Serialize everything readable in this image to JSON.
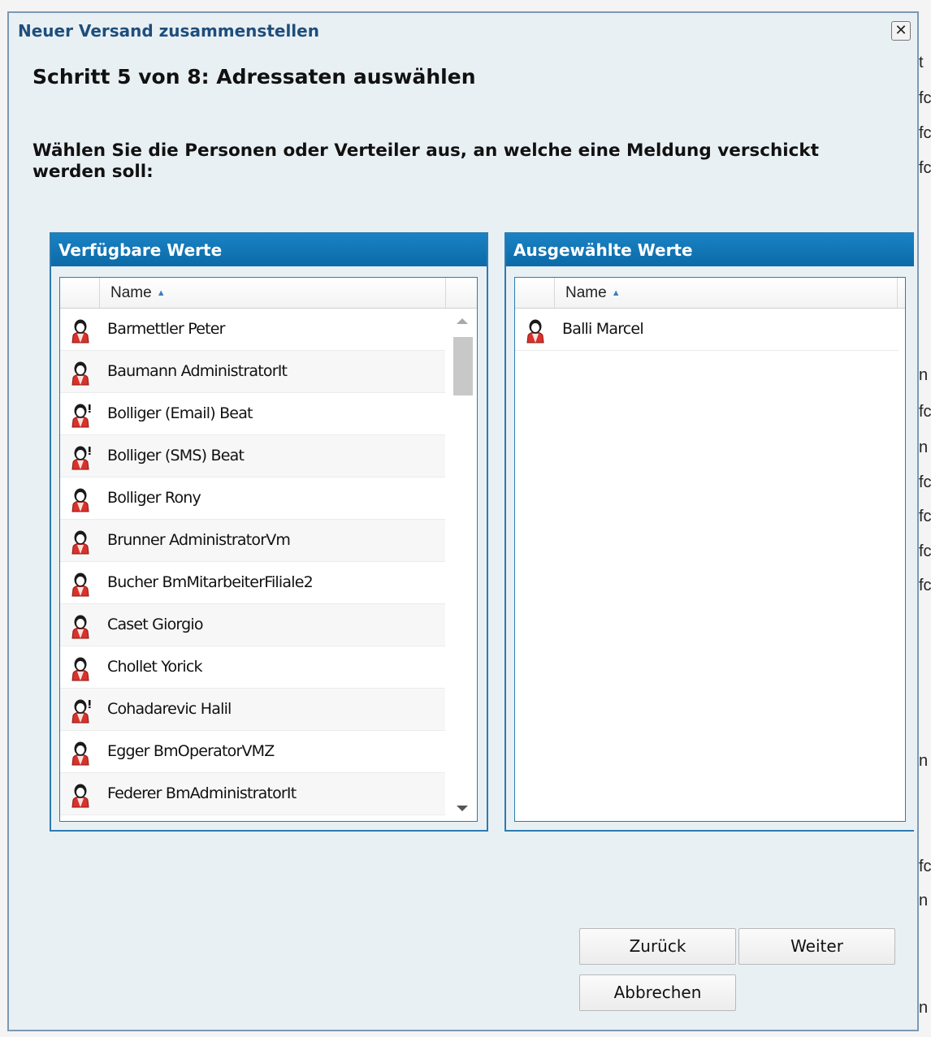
{
  "dialog": {
    "title": "Neuer Versand zusammenstellen",
    "close_symbol": "✕",
    "step_title": "Schritt 5 von 8: Adressaten auswählen",
    "instruction": "Wählen Sie die Personen oder Verteiler aus, an welche eine Meldung verschickt werden soll:"
  },
  "available": {
    "header": "Verfügbare Werte",
    "column_name": "Name",
    "sort_indicator": "▲",
    "items": [
      {
        "label": "Barmettler Peter",
        "icon": "person-icon"
      },
      {
        "label": "Baumann AdministratorIt",
        "icon": "person-icon"
      },
      {
        "label": "Bolliger (Email) Beat",
        "icon": "person-alert-icon"
      },
      {
        "label": "Bolliger (SMS) Beat",
        "icon": "person-alert-icon"
      },
      {
        "label": "Bolliger Rony",
        "icon": "person-icon"
      },
      {
        "label": "Brunner AdministratorVm",
        "icon": "person-icon"
      },
      {
        "label": "Bucher BmMitarbeiterFiliale2",
        "icon": "person-icon"
      },
      {
        "label": "Caset Giorgio",
        "icon": "person-icon"
      },
      {
        "label": "Chollet Yorick",
        "icon": "person-icon"
      },
      {
        "label": "Cohadarevic Halil",
        "icon": "person-alert-icon"
      },
      {
        "label": "Egger BmOperatorVMZ",
        "icon": "person-icon"
      },
      {
        "label": "Federer BmAdministratorIt",
        "icon": "person-icon"
      }
    ]
  },
  "selected": {
    "header": "Ausgewählte Werte",
    "column_name": "Name",
    "sort_indicator": "▲",
    "items": [
      {
        "label": "Balli Marcel",
        "icon": "person-icon"
      }
    ]
  },
  "buttons": {
    "back": "Zurück",
    "next": "Weiter",
    "cancel": "Abbrechen"
  },
  "background_fragments": [
    "t",
    "fc",
    "fc",
    "fc",
    "n",
    "fc",
    "n",
    "fc",
    "fc",
    "fc",
    "fc",
    "n",
    "fc",
    "n",
    "n"
  ],
  "colors": {
    "header_blue": "#0c6aa7",
    "title_blue": "#1e4e7c",
    "dialog_bg": "#e9f0f4",
    "icon_red": "#d9322b"
  }
}
